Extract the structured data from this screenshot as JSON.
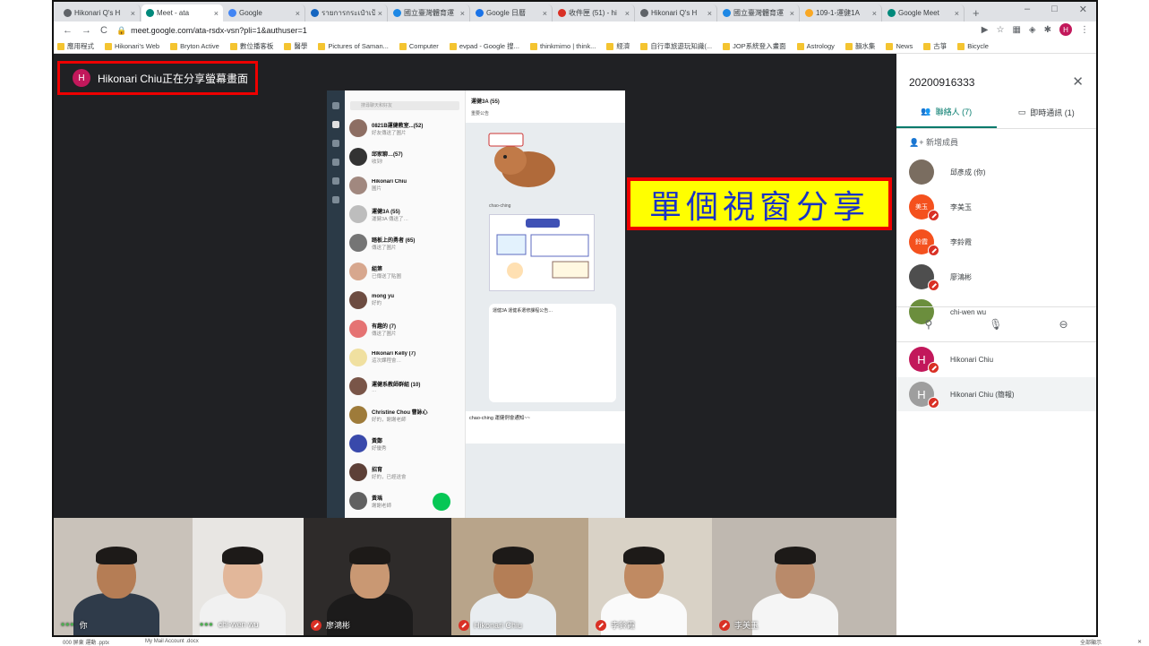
{
  "browser": {
    "tabs": [
      {
        "label": "Hikonari Q's H",
        "color": "#5f6368",
        "active": false
      },
      {
        "label": "Meet - ata",
        "color": "#00897b",
        "active": true
      },
      {
        "label": "Google",
        "color": "#4285f4",
        "active": false
      },
      {
        "label": "รายการกระเป๋าเป้",
        "color": "#1565c0",
        "active": false
      },
      {
        "label": "國立臺灣體育運",
        "color": "#1e88e5",
        "active": false
      },
      {
        "label": "Google 日曆",
        "color": "#1a73e8",
        "active": false
      },
      {
        "label": "收件匣 (51) - hi",
        "color": "#d93025",
        "active": false
      },
      {
        "label": "Hikonari Q's H",
        "color": "#5f6368",
        "active": false
      },
      {
        "label": "國立臺灣體育運",
        "color": "#1e88e5",
        "active": false
      },
      {
        "label": "109-1-運健1A",
        "color": "#f9a825",
        "active": false
      },
      {
        "label": "Google Meet",
        "color": "#00897b",
        "active": false
      }
    ],
    "new_tab": "+",
    "window_controls": [
      "–",
      "□",
      "✕"
    ],
    "url": "meet.google.com/ata-rsdx-vsn?pli=1&authuser=1",
    "profile_initial": "H",
    "bookmarks": [
      "應用程式",
      "Hikonari's Web",
      "Bryton Active",
      "數位播客板",
      "醫學",
      "Pictures of Saman...",
      "Computer",
      "evpad - Google 搜...",
      "thinkmimo | think...",
      "經濟",
      "自行車旅遊玩知識(...",
      "JOP系統登入畫面",
      "Astrology",
      "韻水集",
      "News",
      "古箏",
      "Bicycle"
    ]
  },
  "meet": {
    "presenter_initial": "H",
    "presenter_text": "Hikonari Chiu正在分享螢幕畫面",
    "overlay_label": "單個視窗分享",
    "shared_window": {
      "search_placeholder": "搜尋聊天和好友",
      "chat_title": "運健3A (55)",
      "chat_list": [
        {
          "name": "0821B運健教室...(52)",
          "preview": "好友傳送了圖片",
          "color": "#8d6e63"
        },
        {
          "name": "邱家聊…(57)",
          "preview": "收到!",
          "color": "#333333"
        },
        {
          "name": "Hikonari Chiu",
          "preview": "圖片",
          "color": "#a1887f"
        },
        {
          "name": "運健3A (55)",
          "preview": "運健3A 傳送了…",
          "color": "#bdbdbd"
        },
        {
          "name": "踏板上的勇者 (65)",
          "preview": "傳送了圖片",
          "color": "#757575"
        },
        {
          "name": "組第",
          "preview": "已傳送了貼圖",
          "color": "#d7a78e"
        },
        {
          "name": "mong yu",
          "preview": "好的",
          "color": "#6d4c41"
        },
        {
          "name": "有趣的 (7)",
          "preview": "傳送了圖片",
          "color": "#e57373"
        },
        {
          "name": "Hikonari Kelly (7)",
          "preview": "這次課程會…",
          "color": "#f0e0a0"
        },
        {
          "name": "運健系教師群組 (10)",
          "preview": "…",
          "color": "#795548"
        },
        {
          "name": "Christine Chou 曹詠心",
          "preview": "好的，謝謝老師",
          "color": "#9e7b3a"
        },
        {
          "name": "黃鄭",
          "preview": "好優秀",
          "color": "#3949ab"
        },
        {
          "name": "招育",
          "preview": "好的，已經送會",
          "color": "#5d4037"
        },
        {
          "name": "黃瑀",
          "preview": "謝謝老師",
          "color": "#616161"
        },
        {
          "name": "劉怡瑤",
          "preview": "",
          "color": "#4e342e"
        }
      ],
      "announcement": "重要公告",
      "bubble_text": "運健3A 運健系選修課程公告…",
      "sender": "chao-ching",
      "input_preview": "chao-ching 運健例會通知~~"
    },
    "participants_strip": [
      {
        "name": "你",
        "muted": false,
        "bg": "#c9c2ba",
        "skin": "#b57d55",
        "shirt": "#2f3b4a"
      },
      {
        "name": "chi-wen wu",
        "muted": false,
        "bg": "#e8e6e3",
        "skin": "#e2b79a",
        "shirt": "#f1f1f1"
      },
      {
        "name": "廖鴻彬",
        "muted": true,
        "bg": "#2e2b2a",
        "skin": "#c99873",
        "shirt": "#1c1b1b"
      },
      {
        "name": "Hikonari Chiu",
        "muted": true,
        "bg": "#b8a48a",
        "skin": "#b47e56",
        "shirt": "#e9edf0"
      },
      {
        "name": "李鈴霞",
        "muted": true,
        "bg": "#d9d2c6",
        "skin": "#c08a62",
        "shirt": "#fafafa"
      },
      {
        "name": "李美玉",
        "muted": true,
        "bg": "#bfb8b0",
        "skin": "#b98a6a",
        "shirt": "#f5f5f5"
      }
    ]
  },
  "panel": {
    "title": "20200916333",
    "tab_people": "聯絡人 (7)",
    "tab_chat": "即時通訊 (1)",
    "add_people": "新增成員",
    "people": [
      {
        "name": "邱彥成 (你)",
        "avatar_text": "",
        "color": "#7a6d60",
        "muted": false
      },
      {
        "name": "李美玉",
        "avatar_text": "美玉",
        "color": "#f4511e",
        "muted": true
      },
      {
        "name": "李鈴霞",
        "avatar_text": "鈴霞",
        "color": "#f4511e",
        "muted": true
      },
      {
        "name": "廖鴻彬",
        "avatar_text": "",
        "color": "#4e4e4e",
        "muted": true
      },
      {
        "name": "chi-wen wu",
        "avatar_text": "",
        "color": "#6b8e3d",
        "muted": false
      }
    ],
    "presenters": [
      {
        "name": "Hikonari Chiu",
        "avatar_text": "H",
        "color": "#c2185b"
      },
      {
        "name": "Hikonari Chiu (簡報)",
        "avatar_text": "H",
        "color": "#9e9e9e"
      }
    ]
  },
  "downloads": {
    "items": [
      "000 屏東 運動 .pptx",
      "My Mail Account .docx"
    ],
    "show_all": "全部顯示",
    "close": "✕"
  }
}
